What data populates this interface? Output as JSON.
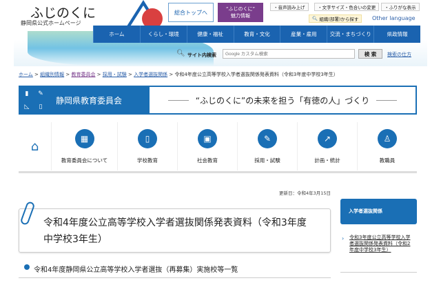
{
  "header": {
    "logo_title": "ふじのくに",
    "logo_subtitle": "静岡県公式ホームページ",
    "top_button": "総合トップへ",
    "charm_button": [
      "“ふじのくに”",
      "魅力情報"
    ],
    "tools": [
      "音声読み上げ",
      "文字サイズ・色合いの変更",
      "ふりがな表示"
    ],
    "org_search": "組織(部署)から探す",
    "other_language": "Other language",
    "nav": [
      "ホーム",
      "くらし・環境",
      "健康・福祉",
      "教育・文化",
      "産業・雇用",
      "交流・まちづくり",
      "県政情報"
    ],
    "search_label": "サイト内検索",
    "search_placeholder": "Google カスタム検索",
    "search_button": "検 索",
    "search_help": "検索の仕方"
  },
  "breadcrumb": [
    "ホーム",
    "組織別情報",
    "教育委員会",
    "採用・試験",
    "入学者選抜関係"
  ],
  "breadcrumb_current": "令和4年度公立高等学校入学者選抜関係発表資料（令和3年度中学校3年生）",
  "banner": {
    "org": "静岡県教育委員会",
    "slogan": "“ふじのくに”の未来を担う「有徳の人」づくり"
  },
  "icon_nav": [
    {
      "label": "教育委員会について",
      "icon": "building-icon"
    },
    {
      "label": "学校教育",
      "icon": "book-icon"
    },
    {
      "label": "社会教育",
      "icon": "device-icon"
    },
    {
      "label": "採用・試験",
      "icon": "pencil-icon"
    },
    {
      "label": "計画・統計",
      "icon": "chart-icon"
    },
    {
      "label": "教職員",
      "icon": "teacher-icon"
    }
  ],
  "main": {
    "updated": "更新日：令和4年3月15日",
    "title": "令和4年度公立高等学校入学者選抜関係発表資料（令和3年度中学校3年生）",
    "subheading": "令和4年度静岡県公立高等学校入学者選抜（再募集）実施校等一覧"
  },
  "sidebar": {
    "heading": "入学者選抜関係",
    "link": "令和3年度公立高等学校入学者選抜関係発表資料（令和2年度中学校3年生）"
  },
  "colors": {
    "primary": "#1a6fb5",
    "purple": "#7a3d8c"
  }
}
